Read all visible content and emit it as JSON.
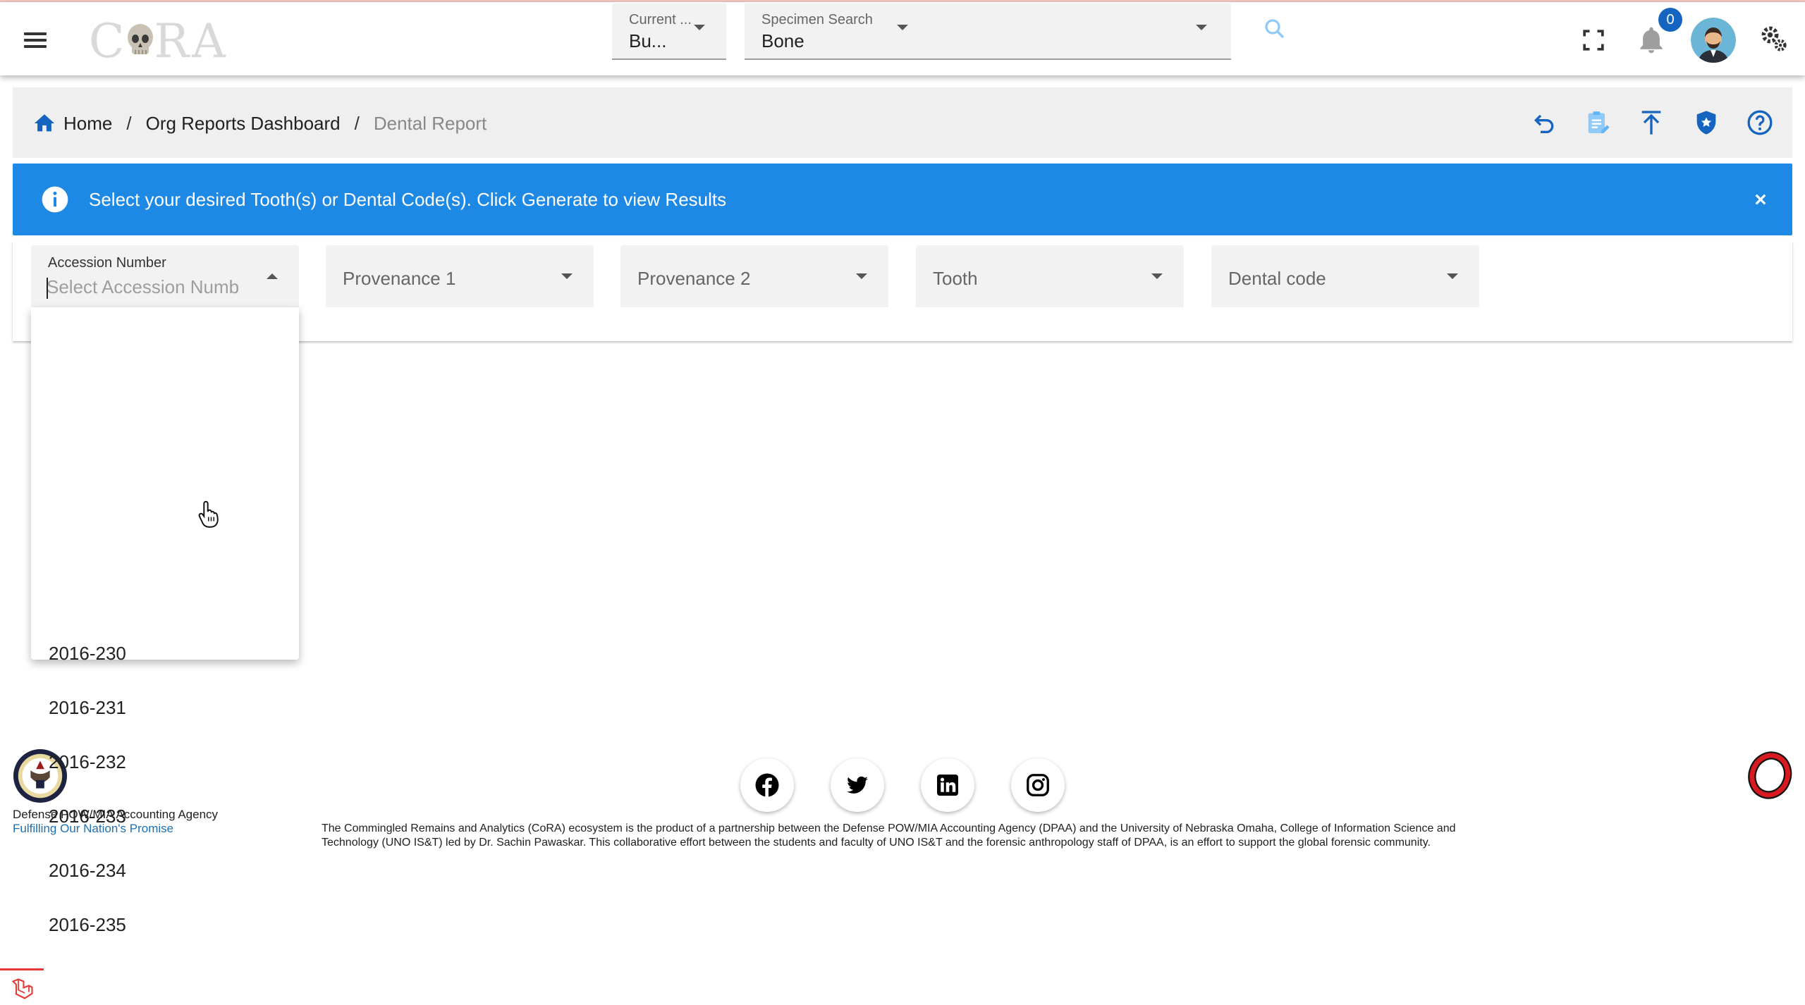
{
  "header": {
    "logo_text_left": "C",
    "logo_text_right": "RA",
    "current_select": {
      "label": "Current ...",
      "value": "Bu..."
    },
    "specimen_search": {
      "label": "Specimen Search",
      "value": "Bone"
    },
    "notification_count": "0"
  },
  "breadcrumb": {
    "home": "Home",
    "dashboard": "Org Reports Dashboard",
    "current": "Dental Report",
    "separator": "/"
  },
  "alert": {
    "message": "Select your desired Tooth(s) or Dental Code(s). Click Generate to view Results"
  },
  "filters": {
    "accession": {
      "label": "Accession Number",
      "placeholder": "Select Accession Numb"
    },
    "provenance1": "Provenance 1",
    "provenance2": "Provenance 2",
    "tooth": "Tooth",
    "dental_code": "Dental code"
  },
  "dropdown_options": [
    "2016-230",
    "2016-231",
    "2016-232",
    "2016-233",
    "2016-234",
    "2016-235"
  ],
  "footer": {
    "agency_name": "Defense POW/MIA Accounting Agency",
    "motto": "Fulfilling Our Nation's Promise",
    "description": "The Commingled Remains and Analytics (CoRA) ecosystem is the product of a partnership between the Defense POW/MIA Accounting Agency (DPAA) and the University of Nebraska Omaha, College of Information Science and Technology (UNO IS&T) led by Dr. Sachin Pawaskar. This collaborative effort between the students and faculty of UNO IS&T and the forensic anthropology staff of DPAA, is an effort to support the global forensic community."
  },
  "colors": {
    "accent": "#1565c0",
    "alert_bg": "#1e88e5",
    "field_bg": "#f2f2f2",
    "link": "#1f6fb2"
  },
  "icons": [
    "menu-icon",
    "skull-icon",
    "search-icon",
    "fullscreen-icon",
    "bell-icon",
    "settings-icon",
    "home-icon",
    "undo-icon",
    "clipboard-icon",
    "upload-icon",
    "shield-icon",
    "help-icon",
    "info-icon",
    "close-icon",
    "facebook-icon",
    "twitter-icon",
    "linkedin-icon",
    "instagram-icon"
  ]
}
